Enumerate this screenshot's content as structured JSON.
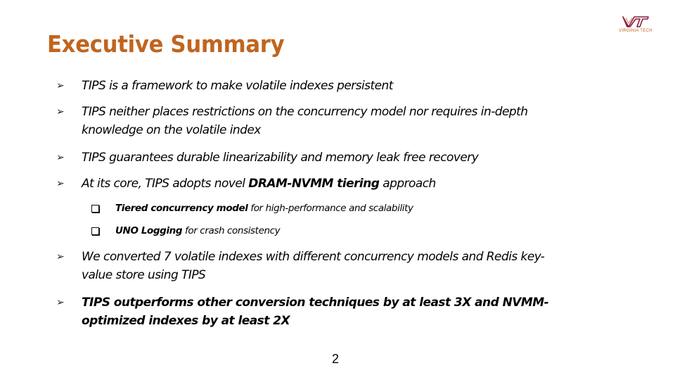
{
  "slide": {
    "title": "Executive Summary",
    "logo": {
      "mark": "VT",
      "text": "VIRGINIA TECH",
      "colors": {
        "maroon": "#861f41",
        "orange": "#c0651f"
      }
    },
    "accent_color": "#c0651f",
    "bullets": [
      {
        "text": "TIPS is a framework to make volatile indexes persistent"
      },
      {
        "text": "TIPS neither places restrictions on the concurrency model nor requires in-depth knowledge on the volatile index"
      },
      {
        "text": "TIPS guarantees durable linearizability and memory leak free recovery"
      },
      {
        "prefix": "At its core, TIPS adopts novel ",
        "bold": "DRAM-NVMM tiering",
        "suffix": " approach",
        "sub_bullets": [
          {
            "bold": "Tiered concurrency model",
            "text": " for high-performance and scalability"
          },
          {
            "bold": "UNO Logging",
            "text": " for crash consistency"
          }
        ]
      },
      {
        "text": "We converted 7 volatile indexes with different concurrency models and Redis key-value store using TIPS"
      },
      {
        "text": "TIPS outperforms other conversion techniques by at least 3X and NVMM-optimized indexes by  at least  2X"
      }
    ],
    "bullet_glyph": "➢",
    "page_number": "2"
  }
}
